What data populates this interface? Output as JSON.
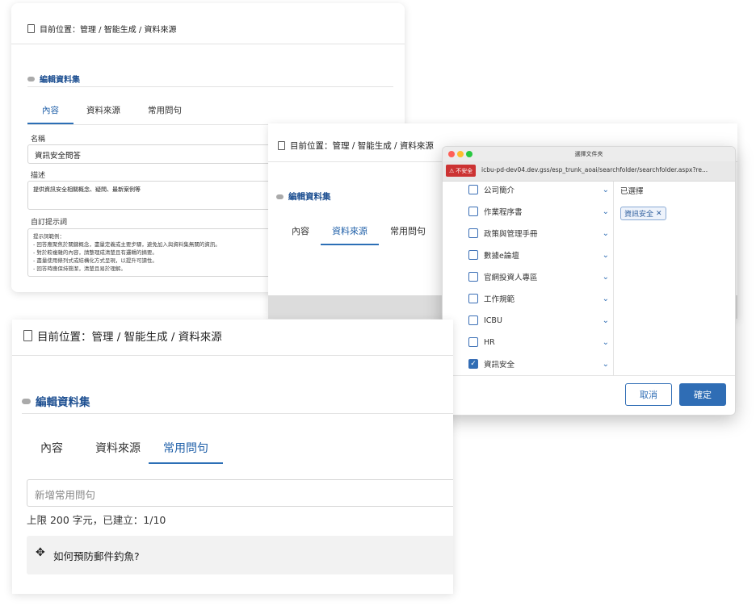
{
  "panel_small": {
    "breadcrumb": "目前位置：管理 / 智能生成 / 資料來源",
    "section": "編輯資料集",
    "tabs": [
      {
        "label": "內容",
        "active": true
      },
      {
        "label": "資料來源",
        "active": false
      },
      {
        "label": "常用問句",
        "active": false
      }
    ],
    "name_label": "名稱",
    "name_value": "資訊安全問答",
    "desc_label": "描述",
    "desc_value": "提供資訊安全相關概念、疑問、最新案例等",
    "prompt_label": "自訂提示詞",
    "prompt_lines": [
      "提示詞範例：",
      "-  回答應聚焦於關鍵概念，盡量定義或主要步驟，避免加入與資料集無關的資訊。",
      "-  對於較複雜的內容，請整理成清楚且有邏輯的摘要。",
      "-  盡量使用條列式或結構化方式呈現，以提升可讀性。",
      "-  回答時應保持簡潔，清楚且易於理解。"
    ]
  },
  "panel_mid": {
    "breadcrumb": "目前位置：管理 / 智能生成 / 資料來源",
    "section": "編輯資料集",
    "tabs": [
      {
        "label": "內容",
        "active": false
      },
      {
        "label": "資料來源",
        "active": true
      },
      {
        "label": "常用問句",
        "active": false
      }
    ]
  },
  "dialog": {
    "title": "選擇文件夾",
    "unsafe_label": "不安全",
    "url": "icbu-pd-dev04.dev.gss/esp_trunk_aoai/searchfolder/searchfolder.aspx?re...",
    "folders": [
      {
        "name": "公司簡介",
        "checked": false
      },
      {
        "name": "作業程序書",
        "checked": false
      },
      {
        "name": "政策與管理手冊",
        "checked": false
      },
      {
        "name": "數據e論壇",
        "checked": false
      },
      {
        "name": "官網投資人專區",
        "checked": false
      },
      {
        "name": "工作規範",
        "checked": false
      },
      {
        "name": "ICBU",
        "checked": false
      },
      {
        "name": "HR",
        "checked": false
      },
      {
        "name": "資訊安全",
        "checked": true
      }
    ],
    "selected_label": "已選擇",
    "selected_tag": "資訊安全",
    "cancel_label": "取消",
    "confirm_label": "確定"
  },
  "panel_front": {
    "breadcrumb": "目前位置：管理 / 智能生成 / 資料來源",
    "section": "編輯資料集",
    "tabs": [
      {
        "label": "內容",
        "active": false
      },
      {
        "label": "資料來源",
        "active": false
      },
      {
        "label": "常用問句",
        "active": true
      }
    ],
    "input_placeholder": "新增常用問句",
    "limit_text": "上限 200 字元，已建立：1/10",
    "question": "如何預防郵件釣魚?"
  },
  "colors": {
    "accent": "#2c6fb6",
    "section": "#1d4f91",
    "confirm": "#2f6db5"
  }
}
